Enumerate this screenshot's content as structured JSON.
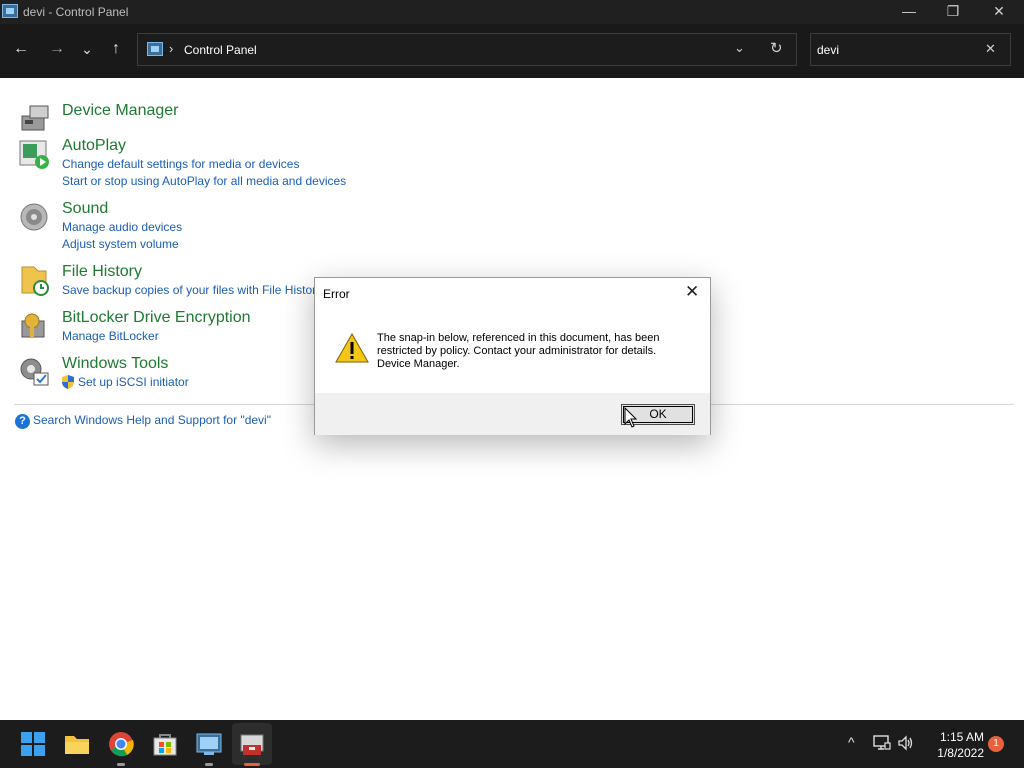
{
  "window": {
    "title": "devi - Control Panel",
    "minimize": "—",
    "restore": "❐",
    "close": "✕"
  },
  "nav": {
    "back": "←",
    "forward": "→",
    "recent": "⌄",
    "up": "↑",
    "breadcrumb": "Control Panel",
    "separator": "›",
    "address_dropdown": "⌄",
    "refresh": "↻"
  },
  "search": {
    "value": "devi",
    "clear": "✕"
  },
  "results": [
    {
      "heading": "Device Manager",
      "icon": "device-manager-icon",
      "links": []
    },
    {
      "heading": "AutoPlay",
      "icon": "autoplay-icon",
      "links": [
        "Change default settings for media or devices",
        "Start or stop using AutoPlay for all media and devices"
      ]
    },
    {
      "heading": "Sound",
      "icon": "sound-icon",
      "links": [
        "Manage audio devices",
        "Adjust system volume"
      ]
    },
    {
      "heading": "File History",
      "icon": "file-history-icon",
      "links": [
        "Save backup copies of your files with File History"
      ]
    },
    {
      "heading": "BitLocker Drive Encryption",
      "icon": "bitlocker-icon",
      "links": [
        "Manage BitLocker"
      ]
    },
    {
      "heading": "Windows Tools",
      "icon": "windows-tools-icon",
      "links": [
        "Set up iSCSI initiator"
      ]
    }
  ],
  "help_link": "Search Windows Help and Support for \"devi\"",
  "dialog": {
    "title": "Error",
    "close": "✕",
    "message_line1": "The snap-in below, referenced in this document, has been restricted by policy. Contact your administrator for details.",
    "message_line2": "Device Manager.",
    "ok_label": "OK"
  },
  "taskbar": {
    "time": "1:15 AM",
    "date": "1/8/2022",
    "notification_count": "1",
    "chevron": "^",
    "apps": [
      "start-icon",
      "file-explorer-icon",
      "chrome-icon",
      "store-icon",
      "control-panel-icon",
      "toolbox-icon"
    ]
  },
  "colors": {
    "heading_green": "#1e7a32",
    "link_blue": "#1a5fb4",
    "titlebar": "#202020",
    "navbar": "#191919",
    "taskbar": "#1c1c1c"
  }
}
